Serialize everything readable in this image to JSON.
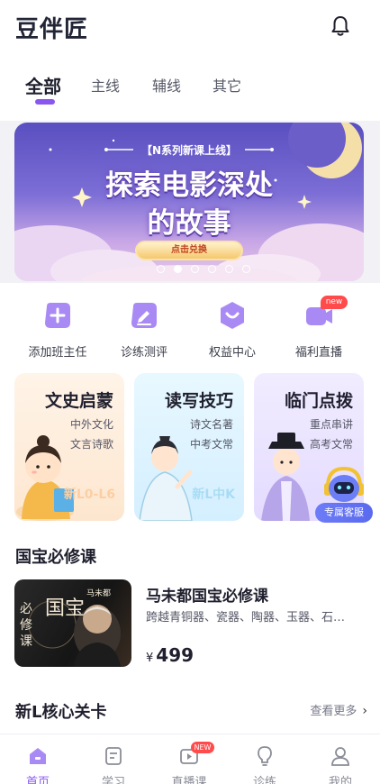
{
  "app": {
    "title": "豆伴匠"
  },
  "header": {
    "bell_icon": "bell-icon"
  },
  "tabs": [
    {
      "label": "全部",
      "active": true
    },
    {
      "label": "主线",
      "active": false
    },
    {
      "label": "辅线",
      "active": false
    },
    {
      "label": "其它",
      "active": false
    }
  ],
  "banner": {
    "subtitle": "【N系列新课上线】",
    "title_line1": "探索电影深处",
    "title_line2": "的故事",
    "button_label": "点击兑换",
    "slide_count": 6,
    "active_slide": 2
  },
  "quick_actions": [
    {
      "label": "添加班主任",
      "icon": "add-icon"
    },
    {
      "label": "诊练测评",
      "icon": "edit-icon"
    },
    {
      "label": "权益中心",
      "icon": "heart-shield-icon"
    },
    {
      "label": "福利直播",
      "icon": "live-camera-icon",
      "badge": "new"
    }
  ],
  "feature_cards": [
    {
      "title": "文史启蒙",
      "line1": "中外文化",
      "line2": "文言诗歌",
      "level": "新L0-L6"
    },
    {
      "title": "读写技巧",
      "line1": "诗文名著",
      "line2": "中考文常",
      "level": "新L中K"
    },
    {
      "title": "临门点拨",
      "line1": "重点串讲",
      "line2": "高考文常",
      "level": "新L"
    }
  ],
  "service": {
    "label": "专属客服"
  },
  "section_guobao": {
    "title": "国宝必修课",
    "course": {
      "name": "马未都国宝必修课",
      "desc": "跨越青铜器、瓷器、陶器、玉器、石…",
      "price_symbol": "¥",
      "price": "499",
      "thumb_text_1": "国宝",
      "thumb_text_2": "必修课",
      "thumb_author": "马未都"
    }
  },
  "section_core": {
    "title": "新L核心关卡",
    "more_label": "查看更多"
  },
  "tabbar": [
    {
      "label": "首页",
      "icon": "home-icon",
      "active": true
    },
    {
      "label": "学习",
      "icon": "study-icon",
      "active": false
    },
    {
      "label": "直播课",
      "icon": "live-icon",
      "active": false,
      "badge": "NEW"
    },
    {
      "label": "诊练",
      "icon": "bulb-icon",
      "active": false
    },
    {
      "label": "我的",
      "icon": "profile-icon",
      "active": false
    }
  ],
  "colors": {
    "accent": "#8a56f0",
    "badge": "#ff4b4b"
  }
}
